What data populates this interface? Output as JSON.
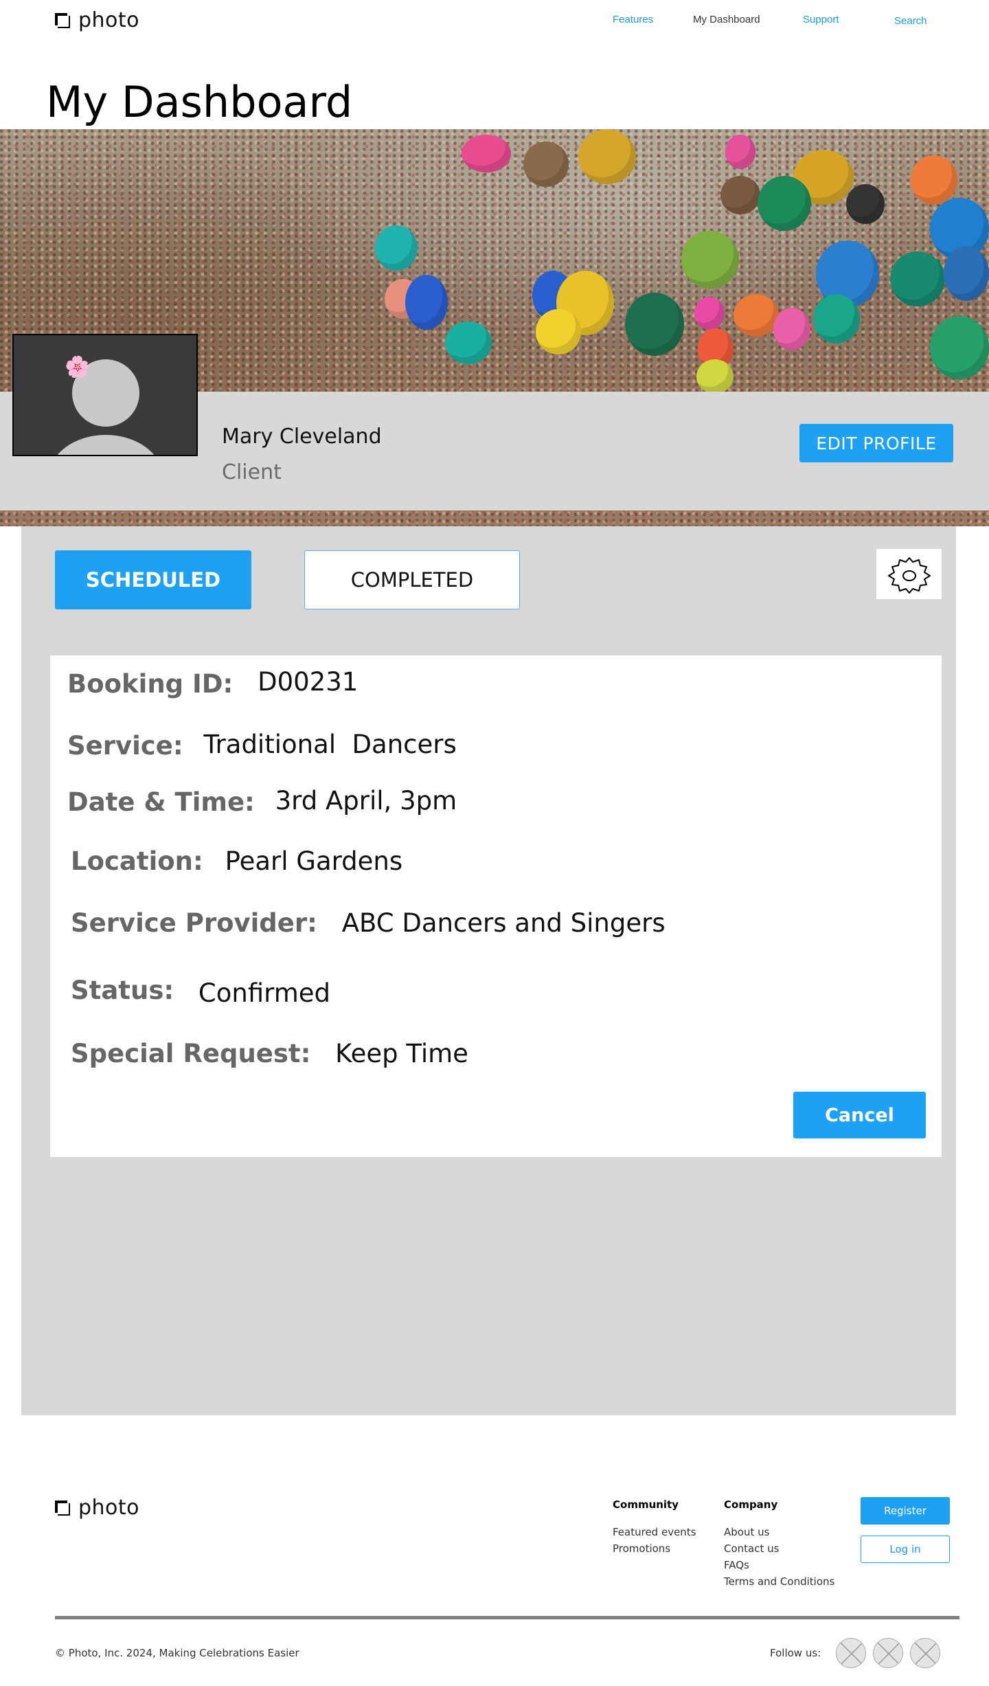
{
  "header": {
    "logo_text": "photo",
    "nav": [
      {
        "label": "Features"
      },
      {
        "label": "My Dashboard"
      },
      {
        "label": "Support"
      },
      {
        "label": "Search"
      }
    ]
  },
  "page_title": "My Dashboard",
  "profile": {
    "name": "Mary Cleveland",
    "role": "Client",
    "edit_label": "EDIT PROFILE",
    "avatar_icon": "user-avatar-icon",
    "avatar_badge": "🌸"
  },
  "tabs": {
    "scheduled": "SCHEDULED",
    "completed": "COMPLETED",
    "settings_icon": "gear-icon"
  },
  "booking": {
    "fields": [
      {
        "label": "Booking ID:",
        "value": "D00231"
      },
      {
        "label": "Service:",
        "value": "Traditional  Dancers"
      },
      {
        "label": "Date & Time:",
        "value": "3rd April, 3pm"
      },
      {
        "label": "Location:",
        "value": "Pearl Gardens"
      },
      {
        "label": "Service Provider:",
        "value": "ABC Dancers and Singers"
      },
      {
        "label": "Status:",
        "value": "Confirmed"
      },
      {
        "label": "Special Request:",
        "value": "Keep Time"
      }
    ],
    "cancel_label": "Cancel"
  },
  "footer": {
    "logo_text": "photo",
    "community": {
      "title": "Community",
      "links": [
        "Featured events",
        "Promotions"
      ]
    },
    "company": {
      "title": "Company",
      "links": [
        "About us",
        "Contact us",
        "FAQs",
        "Terms and Conditions"
      ]
    },
    "register_label": "Register",
    "login_label": "Log in",
    "copyright": "© Photo, Inc. 2024, Making Celebrations Easier",
    "follow_label": "Follow us:",
    "social_icons": [
      "social-placeholder-icon",
      "social-placeholder-icon",
      "social-placeholder-icon"
    ]
  },
  "colors": {
    "accent": "#1ea1f2",
    "panel": "#d8d8d8",
    "label_gray": "#666666"
  }
}
